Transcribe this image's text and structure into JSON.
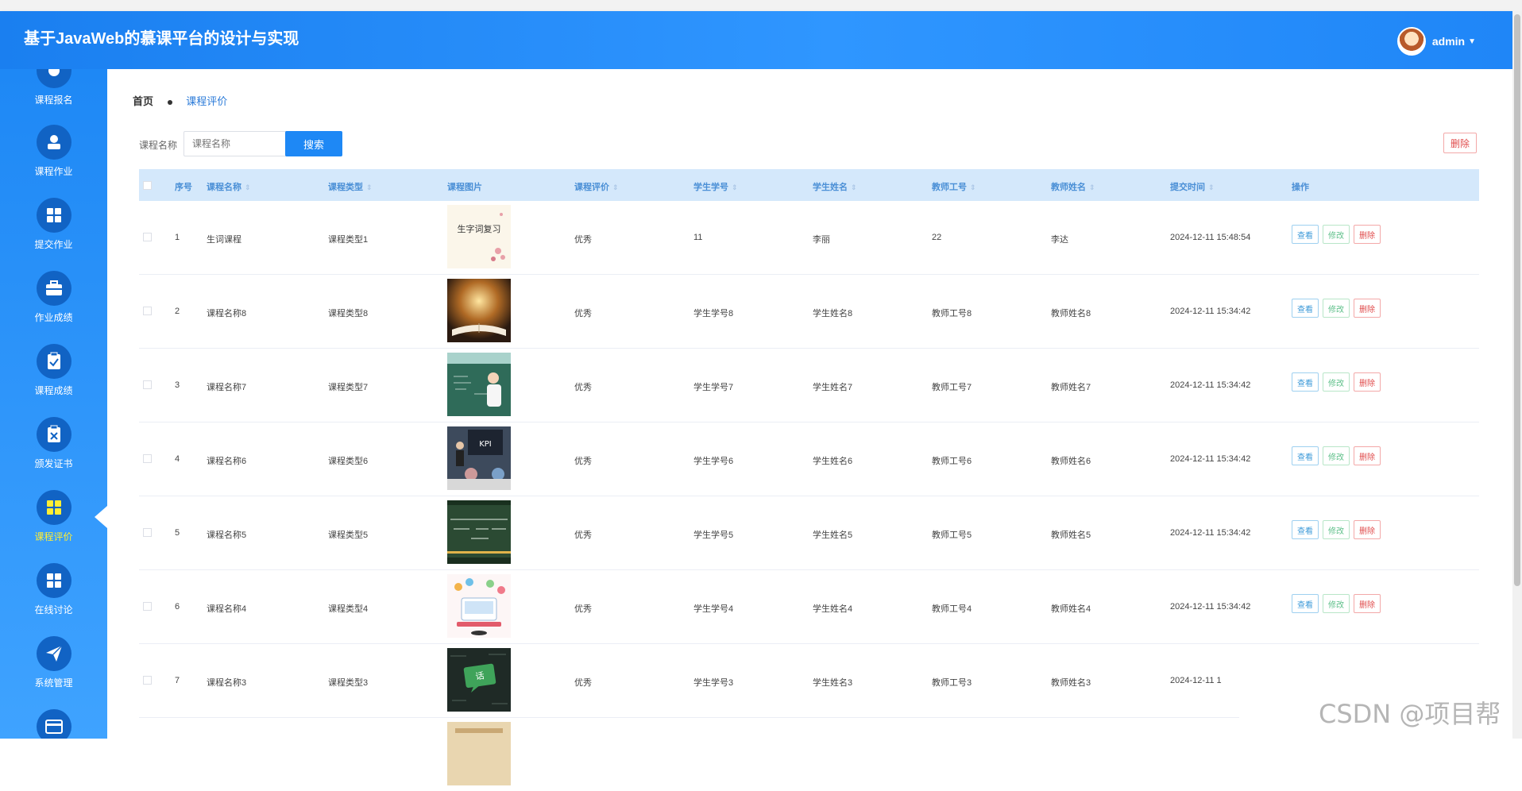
{
  "app": {
    "title": "基于JavaWeb的慕课平台的设计与实现",
    "user": "admin"
  },
  "sidebar": [
    {
      "label": "课程报名",
      "icon": "course-signup-icon"
    },
    {
      "label": "课程作业",
      "icon": "user-icon"
    },
    {
      "label": "提交作业",
      "icon": "grid-icon"
    },
    {
      "label": "作业成绩",
      "icon": "briefcase-icon"
    },
    {
      "label": "课程成绩",
      "icon": "clipboard-check-icon"
    },
    {
      "label": "颁发证书",
      "icon": "clipboard-x-icon"
    },
    {
      "label": "课程评价",
      "icon": "grid-icon",
      "active": true
    },
    {
      "label": "在线讨论",
      "icon": "grid-icon"
    },
    {
      "label": "系统管理",
      "icon": "send-icon"
    },
    {
      "label": "",
      "icon": "wallet-icon"
    }
  ],
  "breadcrumb": {
    "home": "首页",
    "current": "课程评价"
  },
  "search": {
    "label": "课程名称",
    "placeholder": "课程名称",
    "button": "搜索"
  },
  "delete_all": "删除",
  "table": {
    "headers": [
      "序号",
      "课程名称",
      "课程类型",
      "课程图片",
      "课程评价",
      "学生学号",
      "学生姓名",
      "教师工号",
      "教师姓名",
      "提交时间",
      "操作"
    ],
    "actions": {
      "view": "查看",
      "edit": "修改",
      "delete": "删除"
    },
    "rows": [
      {
        "no": "1",
        "name": "生词课程",
        "type": "课程类型1",
        "eval": "优秀",
        "sid": "11",
        "sname": "李丽",
        "tid": "22",
        "tname": "李达",
        "time": "2024-12-11 15:48:54",
        "img": "vocab-review",
        "thumb_text": "生字词复习"
      },
      {
        "no": "2",
        "name": "课程名称8",
        "type": "课程类型8",
        "eval": "优秀",
        "sid": "学生学号8",
        "sname": "学生姓名8",
        "tid": "教师工号8",
        "tname": "教师姓名8",
        "time": "2024-12-11 15:34:42",
        "img": "book-light"
      },
      {
        "no": "3",
        "name": "课程名称7",
        "type": "课程类型7",
        "eval": "优秀",
        "sid": "学生学号7",
        "sname": "学生姓名7",
        "tid": "教师工号7",
        "tname": "教师姓名7",
        "time": "2024-12-11 15:34:42",
        "img": "chalkboard-teacher"
      },
      {
        "no": "4",
        "name": "课程名称6",
        "type": "课程类型6",
        "eval": "优秀",
        "sid": "学生学号6",
        "sname": "学生姓名6",
        "tid": "教师工号6",
        "tname": "教师姓名6",
        "time": "2024-12-11 15:34:42",
        "img": "kpi-meeting",
        "thumb_text": "KPI"
      },
      {
        "no": "5",
        "name": "课程名称5",
        "type": "课程类型5",
        "eval": "优秀",
        "sid": "学生学号5",
        "sname": "学生姓名5",
        "tid": "教师工号5",
        "tname": "教师姓名5",
        "time": "2024-12-11 15:34:42",
        "img": "green-board"
      },
      {
        "no": "6",
        "name": "课程名称4",
        "type": "课程类型4",
        "eval": "优秀",
        "sid": "学生学号4",
        "sname": "学生姓名4",
        "tid": "教师工号4",
        "tname": "教师姓名4",
        "time": "2024-12-11 15:34:42",
        "img": "online-learning"
      },
      {
        "no": "7",
        "name": "课程名称3",
        "type": "课程类型3",
        "eval": "优秀",
        "sid": "学生学号3",
        "sname": "学生姓名3",
        "tid": "教师工号3",
        "tname": "教师姓名3",
        "time": "2024-12-11 1",
        "img": "dark-board"
      }
    ]
  },
  "watermark": "CSDN @项目帮"
}
